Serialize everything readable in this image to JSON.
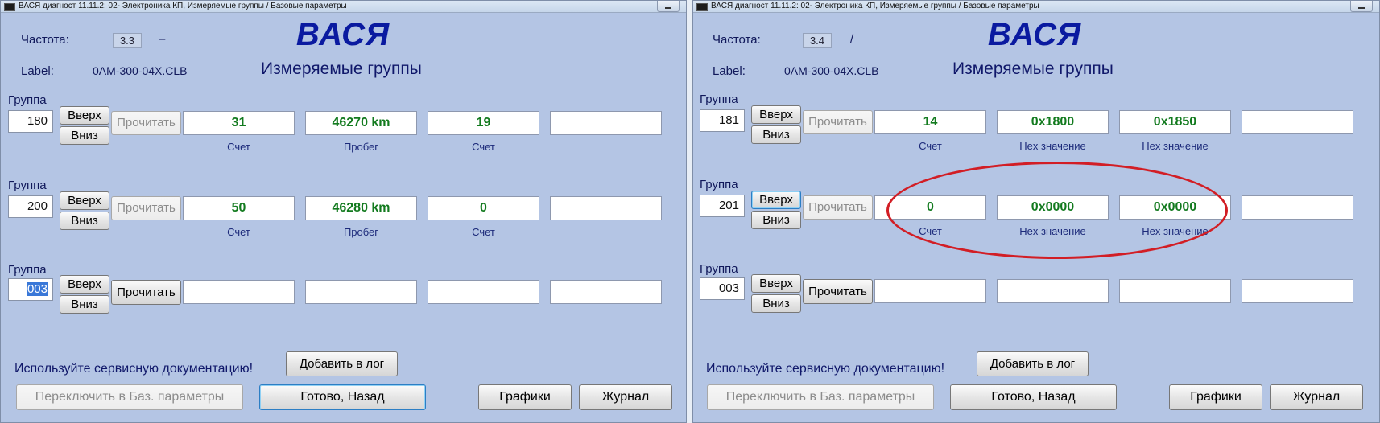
{
  "windows": [
    {
      "title": "ВАСЯ диагност 11.11.2: 02- Электроника КП,  Измеряемые группы / Базовые параметры",
      "freq_label": "Частота:",
      "freq_value": "3.3",
      "freq_indicator": "–",
      "label_label": "Label:",
      "label_value": "0AM-300-04X.CLB",
      "brand": "ВАСЯ",
      "subtitle": "Измеряемые группы",
      "groups": [
        {
          "label": "Группа",
          "number": "180",
          "up": "Вверх",
          "down": "Вниз",
          "read": "Прочитать",
          "fields": [
            {
              "value": "31",
              "unit": "Счет"
            },
            {
              "value": "46270 km",
              "unit": "Пробег"
            },
            {
              "value": "19",
              "unit": "Счет"
            },
            {
              "value": "",
              "unit": ""
            }
          ]
        },
        {
          "label": "Группа",
          "number": "200",
          "up": "Вверх",
          "down": "Вниз",
          "read": "Прочитать",
          "fields": [
            {
              "value": "50",
              "unit": "Счет"
            },
            {
              "value": "46280 km",
              "unit": "Пробег"
            },
            {
              "value": "0",
              "unit": "Счет"
            },
            {
              "value": "",
              "unit": ""
            }
          ]
        },
        {
          "label": "Группа",
          "number": "003",
          "up": "Вверх",
          "down": "Вниз",
          "read": "Прочитать",
          "fields": [
            {
              "value": "",
              "unit": ""
            },
            {
              "value": "",
              "unit": ""
            },
            {
              "value": "",
              "unit": ""
            },
            {
              "value": "",
              "unit": ""
            }
          ]
        }
      ],
      "hint": "Используйте сервисную документацию!",
      "add_log": "Добавить в лог",
      "switch_basic": "Переключить в Баз. параметры",
      "done_back": "Готово, Назад",
      "graphs": "Графики",
      "journal": "Журнал"
    },
    {
      "title": "ВАСЯ диагност 11.11.2: 02- Электроника КП,  Измеряемые группы / Базовые параметры",
      "freq_label": "Частота:",
      "freq_value": "3.4",
      "freq_indicator": "/",
      "label_label": "Label:",
      "label_value": "0AM-300-04X.CLB",
      "brand": "ВАСЯ",
      "subtitle": "Измеряемые группы",
      "groups": [
        {
          "label": "Группа",
          "number": "181",
          "up": "Вверх",
          "down": "Вниз",
          "read": "Прочитать",
          "fields": [
            {
              "value": "14",
              "unit": "Счет"
            },
            {
              "value": "0x1800",
              "unit": "Hex значение"
            },
            {
              "value": "0x1850",
              "unit": "Hex значение"
            },
            {
              "value": "",
              "unit": ""
            }
          ]
        },
        {
          "label": "Группа",
          "number": "201",
          "up": "Вверх",
          "down": "Вниз",
          "read": "Прочитать",
          "fields": [
            {
              "value": "0",
              "unit": "Счет"
            },
            {
              "value": "0x0000",
              "unit": "Hex значение"
            },
            {
              "value": "0x0000",
              "unit": "Hex значение"
            },
            {
              "value": "",
              "unit": ""
            }
          ]
        },
        {
          "label": "Группа",
          "number": "003",
          "up": "Вверх",
          "down": "Вниз",
          "read": "Прочитать",
          "fields": [
            {
              "value": "",
              "unit": ""
            },
            {
              "value": "",
              "unit": ""
            },
            {
              "value": "",
              "unit": ""
            },
            {
              "value": "",
              "unit": ""
            }
          ]
        }
      ],
      "hint": "Используйте сервисную документацию!",
      "add_log": "Добавить в лог",
      "switch_basic": "Переключить в Баз. параметры",
      "done_back": "Готово, Назад",
      "graphs": "Графики",
      "journal": "Журнал"
    }
  ],
  "colors": {
    "window_bg": "#b4c5e4",
    "value_text": "#127a1e",
    "brand_text": "#0a1aa0",
    "annotation_ellipse": "#d21e25"
  }
}
